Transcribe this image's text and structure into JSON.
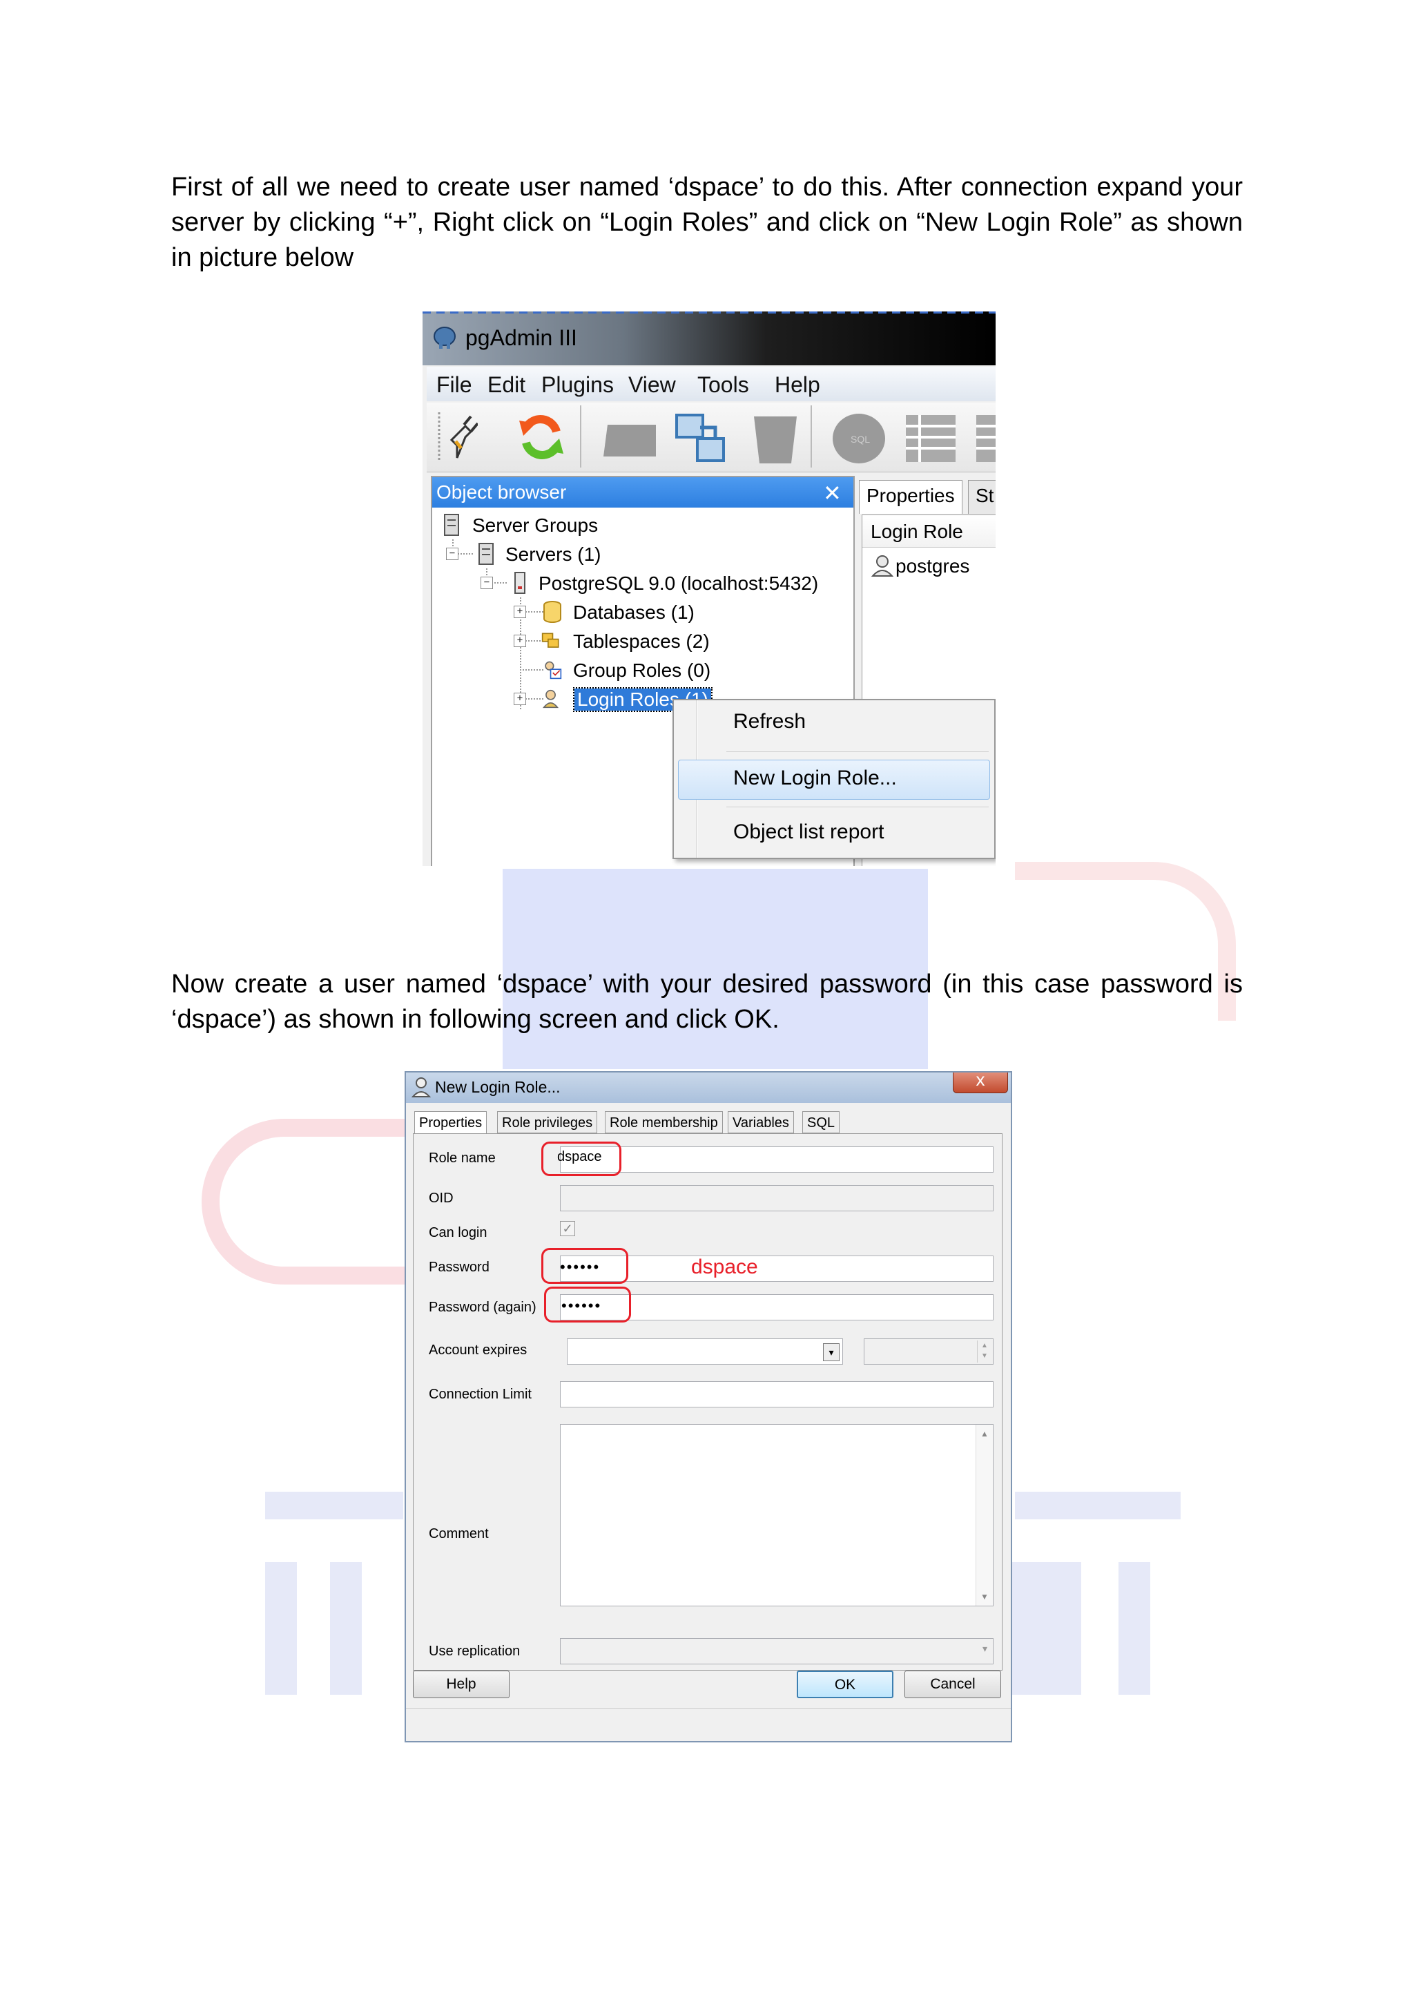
{
  "doc": {
    "para1": "First of all we need to create user named ‘dspace’ to do this. After connection expand your server by clicking “+”, Right click on “Login Roles” and click on “New Login Role” as shown in picture below",
    "para2": "Now create a user named ‘dspace’ with your desired password (in this case password is ‘dspace’) as shown in following screen and click OK."
  },
  "pgadmin": {
    "title": "pgAdmin III",
    "menu": [
      "File",
      "Edit",
      "Plugins",
      "View",
      "Tools",
      "Help"
    ],
    "browser_title": "Object browser",
    "tree": [
      "Server Groups",
      "Servers (1)",
      "PostgreSQL 9.0 (localhost:5432)",
      "Databases (1)",
      "Tablespaces (2)",
      "Group Roles (0)",
      "Login Roles (1)"
    ],
    "props_tabs": [
      "Properties",
      "St"
    ],
    "props_header": "Login Role",
    "props_item": "postgres",
    "context_menu": [
      "Refresh",
      "New Login Role...",
      "Object list report"
    ]
  },
  "dialog": {
    "title": "New Login Role...",
    "close": "x",
    "tabs": [
      "Properties",
      "Role privileges",
      "Role membership",
      "Variables",
      "SQL"
    ],
    "labels": {
      "role_name": "Role name",
      "oid": "OID",
      "can_login": "Can login",
      "password": "Password",
      "password_again": "Password (again)",
      "account_expires": "Account expires",
      "connection_limit": "Connection Limit",
      "comment": "Comment",
      "use_replication": "Use replication"
    },
    "role_name_value": "dspace",
    "password_mask": "••••••",
    "password_again_mask": "••••••",
    "annotation": "dspace",
    "buttons": {
      "help": "Help",
      "ok": "OK",
      "cancel": "Cancel"
    }
  }
}
